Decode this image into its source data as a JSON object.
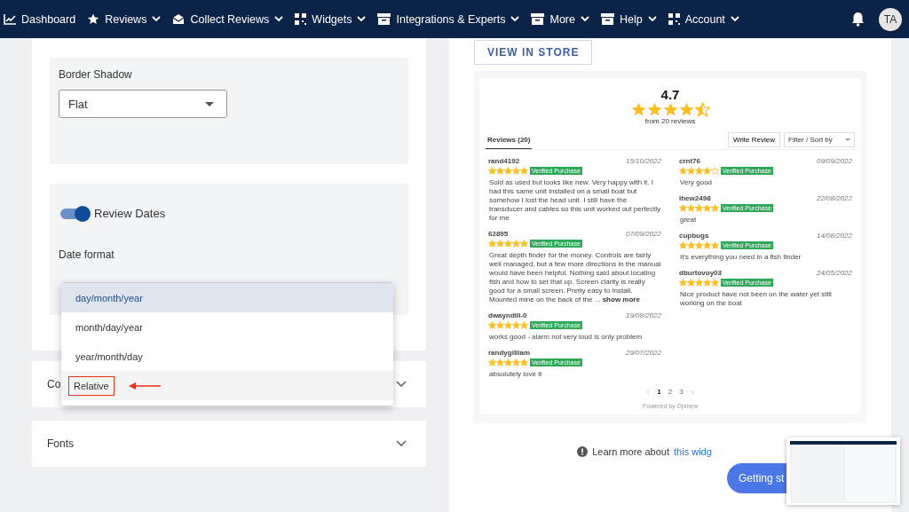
{
  "nav": {
    "items": [
      {
        "label": "Dashboard",
        "caret": false
      },
      {
        "label": "Reviews",
        "caret": true
      },
      {
        "label": "Collect Reviews",
        "caret": true
      },
      {
        "label": "Widgets",
        "caret": true
      },
      {
        "label": "Integrations & Experts",
        "caret": true
      },
      {
        "label": "More",
        "caret": true
      },
      {
        "label": "Help",
        "caret": true
      },
      {
        "label": "Account",
        "caret": true
      }
    ],
    "avatar": "TA"
  },
  "settings": {
    "border_shadow": {
      "label": "Border Shadow",
      "value": "Flat"
    },
    "review_dates": {
      "label": "Review Dates",
      "on": true
    },
    "date_format": {
      "label": "Date format",
      "options": [
        {
          "label": "day/month/year",
          "selected": true,
          "annotated": false
        },
        {
          "label": "month/day/year",
          "selected": false,
          "annotated": false
        },
        {
          "label": "year/month/day",
          "selected": false,
          "annotated": false
        },
        {
          "label": "Relative",
          "selected": false,
          "annotated": true
        }
      ]
    },
    "sections": [
      {
        "label": "Co",
        "expanded": false
      },
      {
        "label": "Fonts",
        "expanded": false
      }
    ]
  },
  "preview": {
    "view_button": "VIEW IN STORE",
    "rating": "4.7",
    "stars": 4.5,
    "count": "from 20 reviews",
    "tab": "Reviews (20)",
    "write_button": "Write Review",
    "sort": "Filter / Sort by",
    "columns": [
      [
        {
          "author": "rand4192",
          "date": "15/10/2022",
          "stars": 5,
          "badge": "Verified Purchase",
          "text": "Sold as used but looks like new. Very happy with it. I had this same unit installed on a small boat but somehow I lost the head unit. I still have the transducer and cables so this unit worked out perfectly for me"
        },
        {
          "author": "62895",
          "date": "07/09/2022",
          "stars": 5,
          "badge": "Verified Purchase",
          "text": "Great depth finder for the money.  Controls are fairly well managed, but a few more directions in the manual would have been helpful.  Nothing said about locating fish and how to set that up.  Screen clarity is really good for a small screen.  Pretty easy to install.  Mounted mine on the back of the  ...",
          "more": "show more"
        },
        {
          "author": "dwayndill-0",
          "date": "19/08/2022",
          "stars": 5,
          "badge": "Verified Purchase",
          "text": "works good -  alarm not very loud is only problem"
        },
        {
          "author": "randygilliam",
          "date": "29/07/2022",
          "stars": 5,
          "badge": "Verified Purchase",
          "text": "absolutely love it"
        }
      ],
      [
        {
          "author": "crnt76",
          "date": "09/09/2022",
          "stars": 4,
          "badge": "Verified Purchase",
          "text": "Very good"
        },
        {
          "author": "lhew2498",
          "date": "22/08/2022",
          "stars": 5,
          "badge": "Verified Purchase",
          "text": "great"
        },
        {
          "author": "cupbugs",
          "date": "14/08/2022",
          "stars": 5,
          "badge": "Verified Purchase",
          "text": "It's everything you need in a fish finder"
        },
        {
          "author": "dburtovoy03",
          "date": "24/05/2022",
          "stars": 5,
          "badge": "Verified Purchase",
          "text": "Nice product have not been on the water yet still working on the boat"
        }
      ]
    ],
    "pages": [
      {
        "label": "1",
        "selected": true
      },
      {
        "label": "2",
        "selected": false
      },
      {
        "label": "3",
        "selected": false
      }
    ],
    "powered": "Powered by Opinew"
  },
  "learn_more": {
    "text": "Learn more about",
    "link": "this widg"
  },
  "getting_started": "Getting st"
}
